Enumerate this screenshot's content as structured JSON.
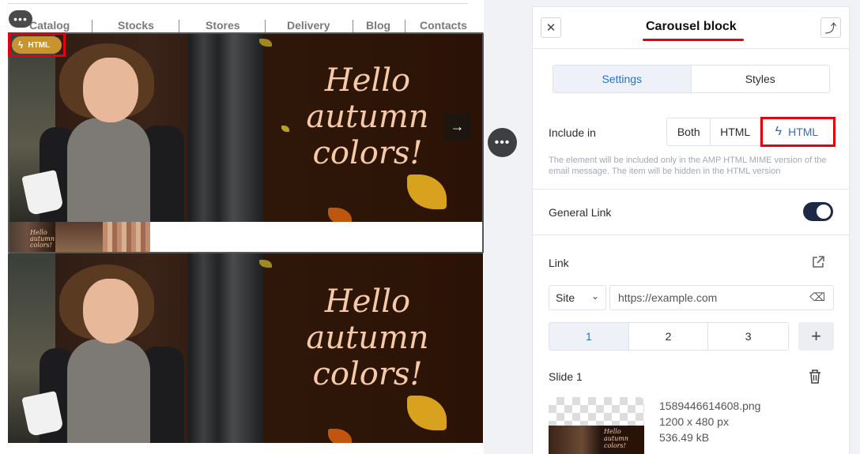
{
  "nav": {
    "items": [
      "Catalog",
      "Stocks",
      "Stores",
      "Delivery",
      "Blog",
      "Contacts"
    ]
  },
  "banner": {
    "text_line1": "Hello",
    "text_line2": "autumn",
    "text_line3": "colors!",
    "thumb_text": "Hello autumn colors!"
  },
  "badge": {
    "label": "HTML"
  },
  "panel": {
    "title": "Carousel block",
    "tabs": [
      "Settings",
      "Styles"
    ],
    "active_tab": "Settings",
    "include_in": {
      "label": "Include in",
      "options": [
        "Both",
        "HTML",
        "HTML"
      ],
      "selected_index": 2,
      "hint": "The element will be included only in the AMP HTML MIME version of the email message. The item will be hidden in the HTML version"
    },
    "general_link": {
      "label": "General Link",
      "enabled": true
    },
    "link": {
      "label": "Link",
      "type_value": "Site",
      "url_placeholder": "https://example.com"
    },
    "slides": {
      "tabs": [
        "1",
        "2",
        "3"
      ],
      "active": "1",
      "add_label": "+"
    },
    "slide": {
      "label": "Slide 1",
      "file_name": "1589446614608.png",
      "dimensions": "1200 x 480 px",
      "size": "536.49 kB"
    }
  },
  "icons": {
    "close": "close-icon",
    "move": "move-up-icon",
    "external": "external-link-icon",
    "trash": "trash-icon",
    "bolt": "lightning-icon",
    "clear": "clear-input-icon"
  },
  "colors": {
    "accent_blue": "#2c6fc9",
    "highlight_red": "#e3000f",
    "badge_gold": "#c9932f",
    "toggle_dark": "#1e2a45"
  }
}
